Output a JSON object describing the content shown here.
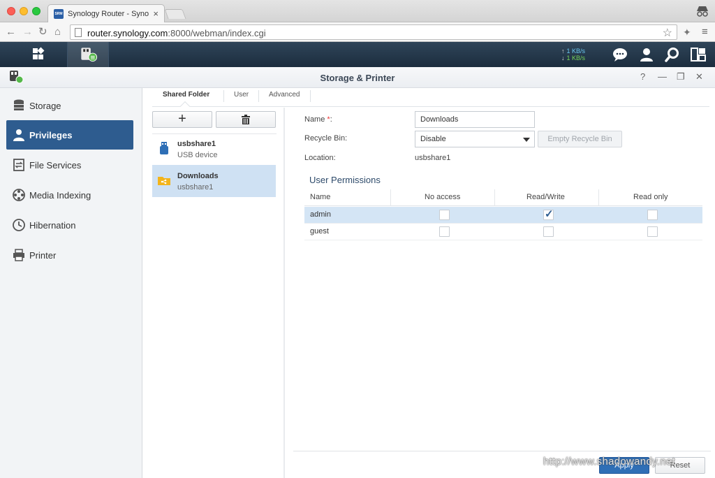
{
  "browser": {
    "tab_title": "Synology Router - Synolog",
    "favicon_text": "SRM",
    "url_host": "router.synology.com",
    "url_path": ":8000/webman/index.cgi"
  },
  "topbar": {
    "upload_speed": "1 KB/s",
    "download_speed": "1 KB/s"
  },
  "window": {
    "title": "Storage & Printer",
    "help": "?",
    "minimize": "—",
    "restore": "❐",
    "close": "✕"
  },
  "sidebar": {
    "items": [
      {
        "label": "Storage",
        "icon": "storage-icon"
      },
      {
        "label": "Privileges",
        "icon": "privileges-icon"
      },
      {
        "label": "File Services",
        "icon": "file-services-icon"
      },
      {
        "label": "Media Indexing",
        "icon": "media-indexing-icon"
      },
      {
        "label": "Hibernation",
        "icon": "hibernation-icon"
      },
      {
        "label": "Printer",
        "icon": "printer-icon"
      }
    ]
  },
  "tabs": [
    "Shared Folder",
    "User",
    "Advanced"
  ],
  "toolbar": {
    "add": "+",
    "delete": "🗑"
  },
  "folders": [
    {
      "name": "usbshare1",
      "sub": "USB device"
    },
    {
      "name": "Downloads",
      "sub": "usbshare1"
    }
  ],
  "form": {
    "name_label": "Name",
    "required_mark": "*",
    "name_colon": ":",
    "name_value": "Downloads",
    "recycle_label": "Recycle Bin:",
    "recycle_value": "Disable",
    "empty_recycle": "Empty Recycle Bin",
    "location_label": "Location:",
    "location_value": "usbshare1"
  },
  "permissions": {
    "title": "User Permissions",
    "columns": [
      "Name",
      "No access",
      "Read/Write",
      "Read only"
    ],
    "rows": [
      {
        "name": "admin",
        "no_access": false,
        "read_write": true,
        "read_only": false
      },
      {
        "name": "guest",
        "no_access": false,
        "read_write": false,
        "read_only": false
      }
    ]
  },
  "footer": {
    "apply": "Apply",
    "reset": "Reset"
  },
  "watermark": "http://www.shadowandy.net",
  "colors": {
    "accent": "#2e5c8f",
    "selected_row": "#d4e5f5",
    "topbar": "#1c2d3e"
  }
}
